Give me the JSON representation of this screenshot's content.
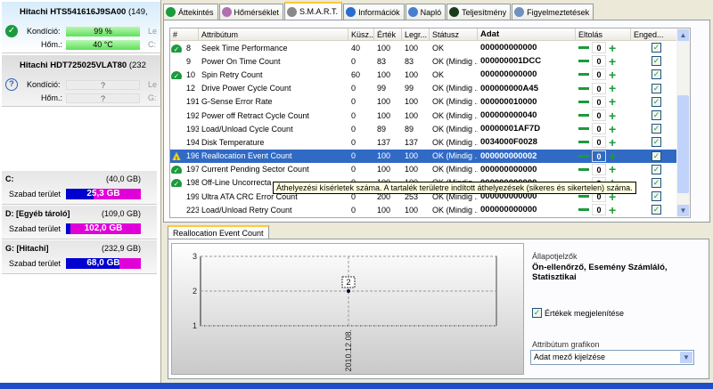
{
  "disks": [
    {
      "name": "Hitachi HTS541616J9SA00",
      "size": "(149,",
      "status": "ok",
      "condition_label": "Kondíció:",
      "condition": "99 %",
      "condition_pct": 99,
      "temp_label": "Hőm.:",
      "temp": "40 °C",
      "right1": "Le",
      "right2": "C:"
    },
    {
      "name": "Hitachi HDT725025VLAT80",
      "size": "(232",
      "status": "unknown",
      "condition_label": "Kondíció:",
      "condition": "?",
      "temp_label": "Hőm.:",
      "temp": "?",
      "right1": "Le",
      "right2": "G:"
    }
  ],
  "partitions": [
    {
      "name": "C:",
      "size": "(40,0 GB)",
      "free_label": "Szabad terület",
      "free": "25,3 GB",
      "used_fraction": 0.37
    },
    {
      "name": "D: [Egyéb tároló]",
      "size": "(109,0 GB)",
      "free_label": "Szabad terület",
      "free": "102,0 GB",
      "used_fraction": 0.06
    },
    {
      "name": "G: [Hitachi]",
      "size": "(232,9 GB)",
      "free_label": "Szabad terület",
      "free": "68,0 GB",
      "used_fraction": 0.71
    }
  ],
  "tabs": [
    {
      "label": "Áttekintés",
      "icon": "check-icon",
      "color": "#1d9a3c"
    },
    {
      "label": "Hőmérséklet",
      "icon": "thermometer-icon",
      "color": "#b070b0"
    },
    {
      "label": "S.M.A.R.T.",
      "icon": "disk-icon",
      "color": "#888888",
      "active": true
    },
    {
      "label": "Információk",
      "icon": "info-icon",
      "color": "#2a6bd0"
    },
    {
      "label": "Napló",
      "icon": "log-icon",
      "color": "#4a7fd0"
    },
    {
      "label": "Teljesítmény",
      "icon": "performance-icon",
      "color": "#1a3a1a"
    },
    {
      "label": "Figyelmeztetések",
      "icon": "alerts-icon",
      "color": "#7090c0"
    }
  ],
  "table": {
    "columns": [
      "#",
      "Attribútum",
      "Küsz...",
      "Érték",
      "Legr...",
      "Státusz",
      "Adat",
      "Eltolás",
      "Enged..."
    ],
    "rows": [
      {
        "status": "ok",
        "id": "8",
        "name": "Seek Time Performance",
        "thr": "40",
        "val": "100",
        "worst": "100",
        "st": "OK",
        "data": "000000000000",
        "offset": "0",
        "enabled": true
      },
      {
        "status": "",
        "id": "9",
        "name": "Power On Time Count",
        "thr": "0",
        "val": "83",
        "worst": "83",
        "st": "OK (Mindig ...",
        "data": "000000001DCC",
        "offset": "0",
        "enabled": true
      },
      {
        "status": "ok",
        "id": "10",
        "name": "Spin Retry Count",
        "thr": "60",
        "val": "100",
        "worst": "100",
        "st": "OK",
        "data": "000000000000",
        "offset": "0",
        "enabled": true
      },
      {
        "status": "",
        "id": "12",
        "name": "Drive Power Cycle Count",
        "thr": "0",
        "val": "99",
        "worst": "99",
        "st": "OK (Mindig ...",
        "data": "000000000A45",
        "offset": "0",
        "enabled": true
      },
      {
        "status": "",
        "id": "191",
        "name": "G-Sense Error Rate",
        "thr": "0",
        "val": "100",
        "worst": "100",
        "st": "OK (Mindig ...",
        "data": "000000010000",
        "offset": "0",
        "enabled": true
      },
      {
        "status": "",
        "id": "192",
        "name": "Power off Retract Cycle Count",
        "thr": "0",
        "val": "100",
        "worst": "100",
        "st": "OK (Mindig ...",
        "data": "000000000040",
        "offset": "0",
        "enabled": true
      },
      {
        "status": "",
        "id": "193",
        "name": "Load/Unload Cycle Count",
        "thr": "0",
        "val": "89",
        "worst": "89",
        "st": "OK (Mindig ...",
        "data": "00000001AF7D",
        "offset": "0",
        "enabled": true
      },
      {
        "status": "",
        "id": "194",
        "name": "Disk Temperature",
        "thr": "0",
        "val": "137",
        "worst": "137",
        "st": "OK (Mindig ...",
        "data": "0034000F0028",
        "offset": "0",
        "enabled": true
      },
      {
        "status": "warn",
        "id": "196",
        "name": "Reallocation Event Count",
        "thr": "0",
        "val": "100",
        "worst": "100",
        "st": "OK (Mindig ...",
        "data": "000000000002",
        "offset": "0",
        "enabled": true,
        "selected": true
      },
      {
        "status": "ok",
        "id": "197",
        "name": "Current Pending Sector Count",
        "thr": "0",
        "val": "100",
        "worst": "100",
        "st": "OK (Mindig ...",
        "data": "000000000000",
        "offset": "0",
        "enabled": true
      },
      {
        "status": "ok",
        "id": "198",
        "name": "Off-Line Uncorrecta",
        "thr": "0",
        "val": "100",
        "worst": "100",
        "st": "OK (Mindig ...",
        "data": "000000000000",
        "offset": "0",
        "enabled": true
      },
      {
        "status": "",
        "id": "199",
        "name": "Ultra ATA CRC Error Count",
        "thr": "0",
        "val": "200",
        "worst": "253",
        "st": "OK (Mindig ...",
        "data": "000000000000",
        "offset": "0",
        "enabled": true
      },
      {
        "status": "",
        "id": "223",
        "name": "Load/Unload Retry Count",
        "thr": "0",
        "val": "100",
        "worst": "100",
        "st": "OK (Mindig ...",
        "data": "000000000000",
        "offset": "0",
        "enabled": true
      }
    ]
  },
  "tooltip": "Áthelyezési kísérletek száma. A tartalék területre indított áthelyezések (sikeres és sikertelen) száma.",
  "bottom": {
    "tab_label": "Reallocation Event Count",
    "flags_label": "Állapotjelzők",
    "flags_value": "Ön-ellenőrző, Esemény Számláló, Statisztikai",
    "show_values_label": "Értékek megjelenítése",
    "show_values": true,
    "graph_label": "Attribútum grafikon",
    "graph_select": "Adat mező kijelzése"
  },
  "chart_data": {
    "type": "line",
    "x": [
      "2010.12.08."
    ],
    "values": [
      2
    ],
    "data_labels": [
      "2"
    ],
    "ylim": [
      1,
      3
    ],
    "yticks": [
      "1",
      "2",
      "3"
    ],
    "grid": true
  }
}
